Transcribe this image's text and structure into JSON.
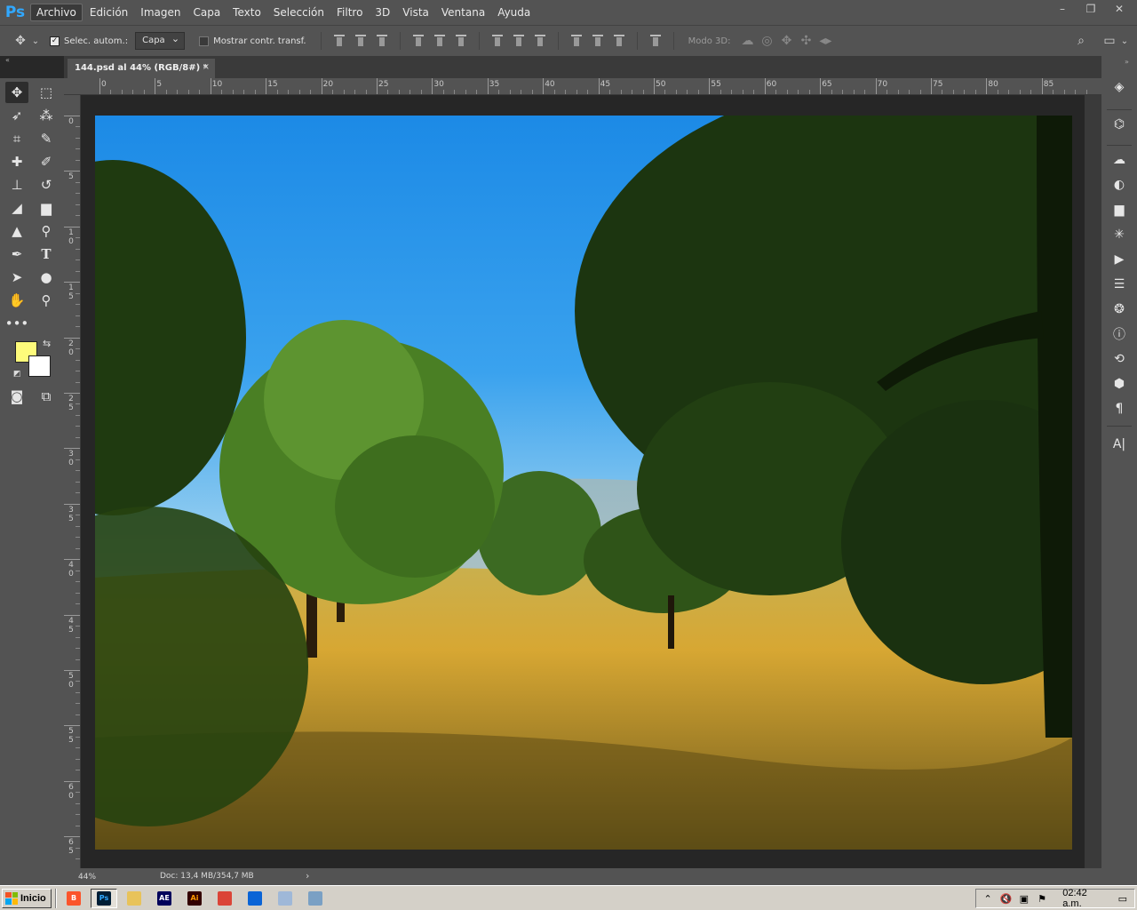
{
  "app": {
    "logo": "Ps",
    "menu": [
      "Archivo",
      "Edición",
      "Imagen",
      "Capa",
      "Texto",
      "Selección",
      "Filtro",
      "3D",
      "Vista",
      "Ventana",
      "Ayuda"
    ],
    "active_menu": "Archivo"
  },
  "window_controls": [
    "–",
    "❐",
    "✕"
  ],
  "options": {
    "auto_select_label": "Selec. autom.:",
    "auto_select_checked": true,
    "auto_select_value": "Capa",
    "show_transform_label": "Mostrar contr. transf.",
    "show_transform_checked": false,
    "mode3d_label": "Modo 3D:"
  },
  "document": {
    "tab_title": "144.psd al 44% (RGB/8#) *",
    "close_label": "×"
  },
  "ruler": {
    "top_labels": [
      "0",
      "5",
      "10",
      "15",
      "20",
      "25",
      "30",
      "35",
      "40",
      "45",
      "50",
      "55",
      "60",
      "65",
      "70",
      "75",
      "80",
      "85"
    ],
    "left_labels": [
      "0",
      "5",
      "10",
      "15",
      "20",
      "25",
      "30",
      "35",
      "40",
      "45",
      "50",
      "55",
      "60",
      "65"
    ]
  },
  "colors": {
    "foreground": "#fefb7b",
    "background": "#ffffff",
    "ps_blue": "#31a8ff"
  },
  "status": {
    "zoom": "44%",
    "doc_info": "Doc: 13,4 MB/354,7 MB"
  },
  "taskbar": {
    "start_label": "Inicio",
    "apps": [
      {
        "name": "brave-icon",
        "label": "B",
        "color": "#fb542b",
        "active": false
      },
      {
        "name": "photoshop-icon",
        "label": "Ps",
        "color": "#001e36",
        "active": true
      },
      {
        "name": "explorer-icon",
        "label": "",
        "color": "#e8c35a",
        "active": false
      },
      {
        "name": "aftereffects-icon",
        "label": "AE",
        "color": "#00005b",
        "active": false
      },
      {
        "name": "illustrator-icon",
        "label": "Ai",
        "color": "#330000",
        "active": false
      },
      {
        "name": "chrome-icon",
        "label": "",
        "color": "#db4437",
        "active": false
      },
      {
        "name": "onedrive-icon",
        "label": "",
        "color": "#0a64d6",
        "active": false
      },
      {
        "name": "notepad-icon",
        "label": "",
        "color": "#9fb8d8",
        "active": false
      },
      {
        "name": "control-panel-icon",
        "label": "",
        "color": "#7aa0c4",
        "active": false
      }
    ],
    "clock": "02:42 a.m."
  }
}
